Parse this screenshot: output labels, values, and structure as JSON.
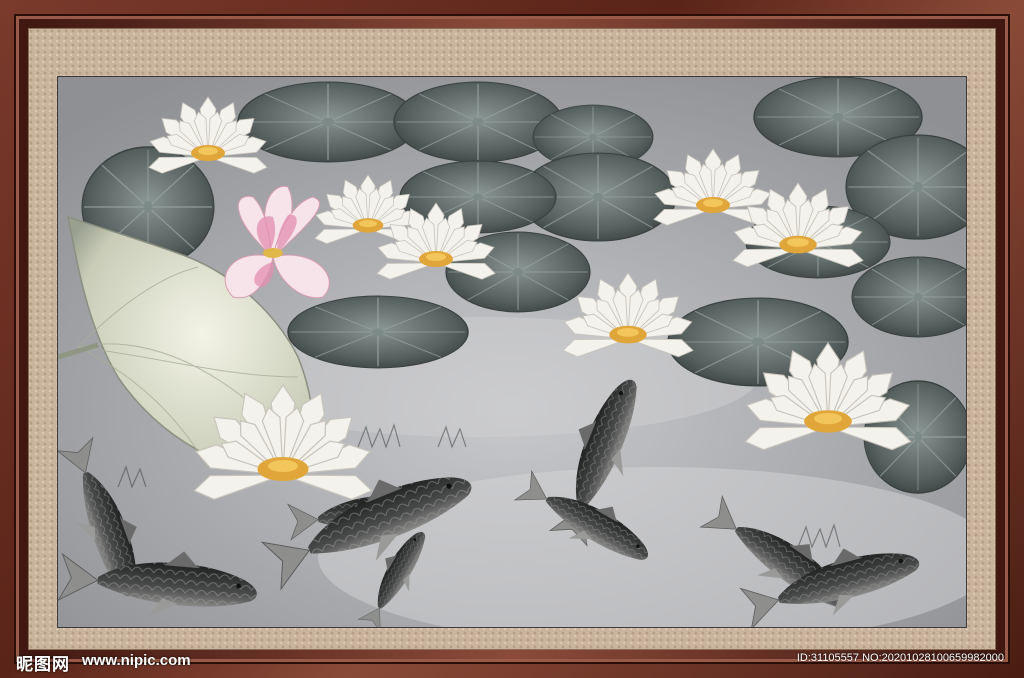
{
  "watermark": {
    "logo_text": "昵图网",
    "url_text": "www.nipic.com",
    "id_text": "ID:31105557 NO:20201028100659982000"
  },
  "colors": {
    "frame": "#6a2e22",
    "mat": "#c9b49e",
    "mist": "#a7a8ac",
    "leaf_dark": "#56605e",
    "lotus_pink": "#e48fb0",
    "lily_white": "#f4f2ec",
    "lily_center": "#e0a63a",
    "koi_dark": "#2f3030"
  }
}
